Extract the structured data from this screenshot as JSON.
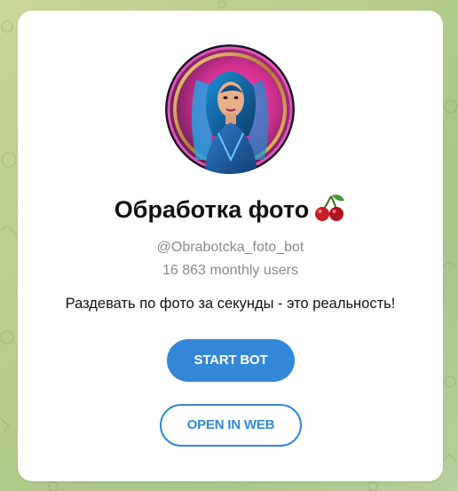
{
  "bot": {
    "title": "Обработка фото",
    "title_emoji": "cherries-icon",
    "username": "@Obrabotcka_foto_bot",
    "monthly_users": "16 863 monthly users",
    "description": "Раздевать по фото за секунды - это реальность!"
  },
  "actions": {
    "start_label": "START BOT",
    "open_web_label": "OPEN IN WEB"
  },
  "colors": {
    "accent": "#3487d7",
    "background": "#b9cd8c",
    "card": "#ffffff",
    "muted_text": "#8a8a8a"
  },
  "avatar": {
    "icon": "bot-avatar-portrait"
  }
}
